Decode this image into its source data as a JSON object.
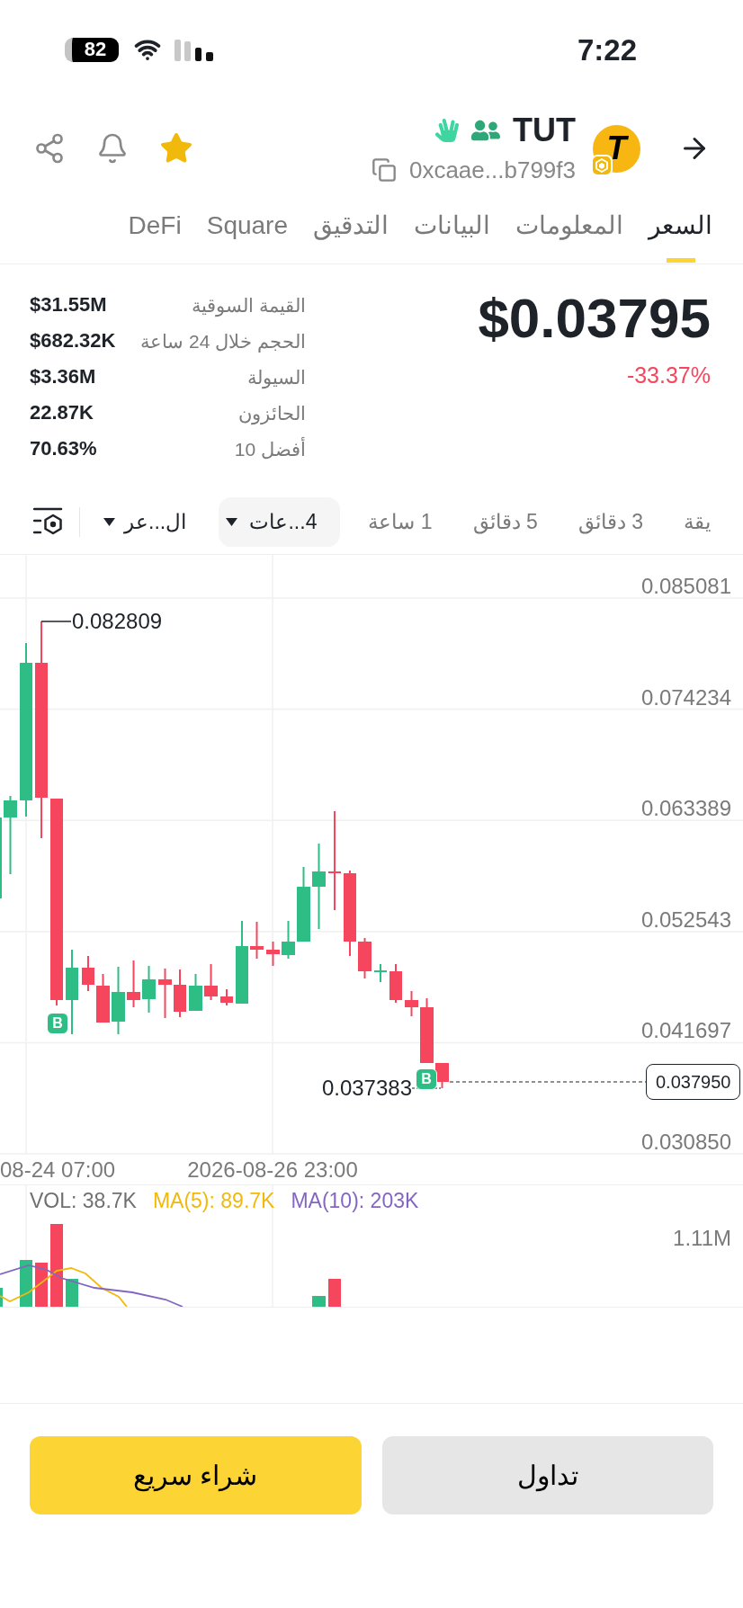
{
  "status_bar": {
    "battery": "82",
    "time": "7:22"
  },
  "header": {
    "symbol": "TUT",
    "logo_text": "T",
    "address": "0xcaae...b799f3",
    "favorite": true
  },
  "tabs": [
    {
      "label": "السعر",
      "selected": true
    },
    {
      "label": "المعلومات",
      "selected": false
    },
    {
      "label": "البيانات",
      "selected": false
    },
    {
      "label": "التدقيق",
      "selected": false
    },
    {
      "label": "Square",
      "selected": false
    },
    {
      "label": "DeFi",
      "selected": false
    }
  ],
  "price": {
    "value": "$0.03795",
    "change": "-33.37%"
  },
  "stats": [
    {
      "label": "القيمة السوقية",
      "value": "$31.55M"
    },
    {
      "label": "الحجم خلال 24 ساعة",
      "value": "$682.32K"
    },
    {
      "label": "السيولة",
      "value": "$3.36M"
    },
    {
      "label": "الحائزون",
      "value": "22.87K"
    },
    {
      "label": "أفضل 10",
      "value": "70.63%"
    }
  ],
  "intervals": [
    {
      "label": "يقة",
      "selected": false,
      "kind": "option"
    },
    {
      "label": "3 دقائق",
      "selected": false,
      "kind": "option"
    },
    {
      "label": "5 دقائق",
      "selected": false,
      "kind": "option"
    },
    {
      "label": "1 ساعة",
      "selected": false,
      "kind": "option"
    },
    {
      "label": "4...عات",
      "selected": true,
      "kind": "dropdown"
    }
  ],
  "chart_type": {
    "label": "ال...عر"
  },
  "price_chart": {
    "y_labels": [
      "0.085081",
      "0.074234",
      "0.063389",
      "0.052543",
      "0.041697",
      "0.030850"
    ],
    "x_labels": [
      "2026-08-26 23:00",
      "08-24 07:00"
    ],
    "high_label": "0.082809",
    "low_label": "0.037383",
    "current_price": "0.037950",
    "markers": [
      {
        "label": "B"
      },
      {
        "label": "B"
      }
    ]
  },
  "volume": {
    "legend": [
      {
        "text": "MA(10): 203K",
        "color": "#8466c2"
      },
      {
        "text": "MA(5): 89.7K",
        "color": "#f0b90b"
      },
      {
        "text": "VOL: 38.7K",
        "color": "#707070"
      }
    ],
    "y_label": "1.11M"
  },
  "buttons": [
    {
      "label": "تداول",
      "kind": "secondary"
    },
    {
      "label": "شراء سريع",
      "kind": "primary"
    }
  ]
}
